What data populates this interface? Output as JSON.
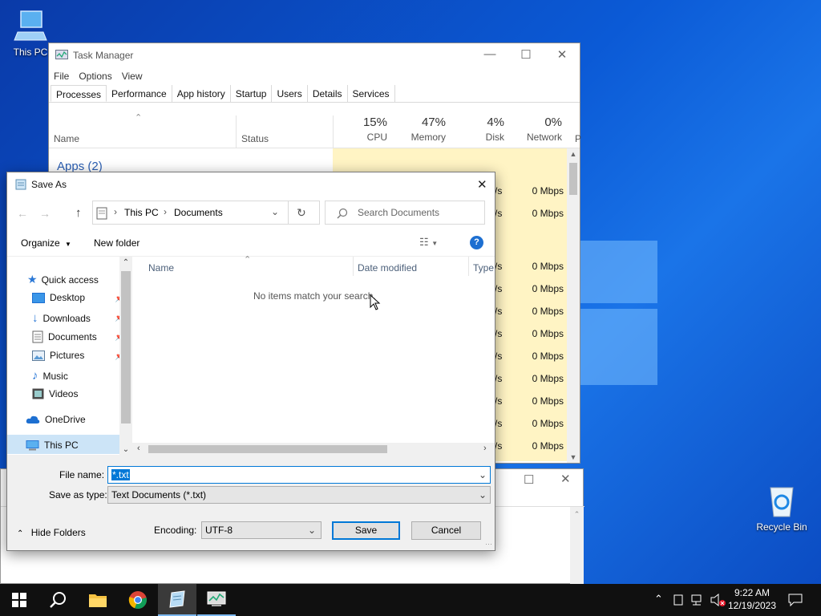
{
  "desktop": {
    "this_pc_label": "This PC",
    "recycle_bin_label": "Recycle Bin"
  },
  "task_manager": {
    "title": "Task Manager",
    "menu": [
      "File",
      "Options",
      "View"
    ],
    "tabs": [
      "Processes",
      "Performance",
      "App history",
      "Startup",
      "Users",
      "Details",
      "Services"
    ],
    "columns": {
      "name": "Name",
      "status": "Status",
      "cpu_pct": "15%",
      "cpu": "CPU",
      "memory_pct": "47%",
      "memory": "Memory",
      "disk_pct": "4%",
      "disk": "Disk",
      "network_pct": "0%",
      "network": "Network",
      "power_trunc": "P"
    },
    "group_apps": "Apps (2)",
    "network_values": [
      "0 Mbps",
      "0 Mbps",
      "0 Mbps",
      "0 Mbps",
      "0 Mbps",
      "0 Mbps",
      "0 Mbps",
      "0 Mbps",
      "0 Mbps",
      "0 Mbps",
      "0 Mbps"
    ],
    "disk_suffix": "/s"
  },
  "save_as": {
    "title": "Save As",
    "breadcrumb": [
      "This PC",
      "Documents"
    ],
    "search_placeholder": "Search Documents",
    "organize": "Organize",
    "new_folder": "New folder",
    "nav": {
      "quick_access": "Quick access",
      "desktop": "Desktop",
      "downloads": "Downloads",
      "documents": "Documents",
      "pictures": "Pictures",
      "music": "Music",
      "videos": "Videos",
      "onedrive": "OneDrive",
      "this_pc": "This PC"
    },
    "columns": {
      "name": "Name",
      "date_modified": "Date modified",
      "type": "Type"
    },
    "empty_message": "No items match your search.",
    "file_name_label": "File name:",
    "file_name_value": "*.txt",
    "save_as_type_label": "Save as type:",
    "save_as_type_value": "Text Documents (*.txt)",
    "hide_folders": "Hide Folders",
    "encoding_label": "Encoding:",
    "encoding_value": "UTF-8",
    "save_button": "Save",
    "cancel_button": "Cancel"
  },
  "taskbar": {
    "time": "9:22 AM",
    "date": "12/19/2023"
  }
}
